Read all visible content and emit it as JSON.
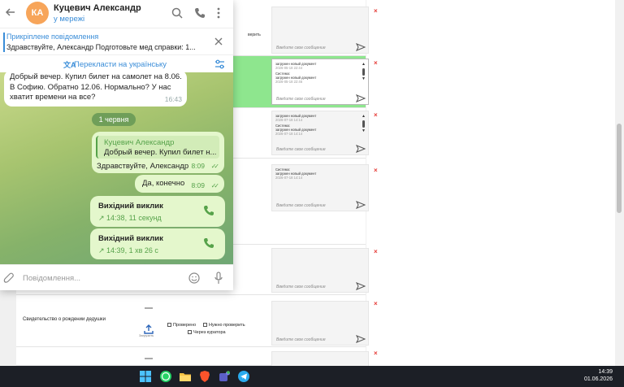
{
  "telegram": {
    "avatar_initials": "КА",
    "chat_name": "Куцевич Александр",
    "chat_status": "у мережі",
    "pinned_title": "Прикріплене повідомлення",
    "pinned_text": "Здравствуйте, Александр Подготовьте мед справки: 1...",
    "translate_label": "Перекласти на українську",
    "translate_icon": "文A",
    "messages": {
      "msg1_text": "Добрый вечер. Купил билет на самолет на 8.06. В Софию. Обратно 12.06. Нормально? У нас хватит времени на все?",
      "msg1_time": "16:43",
      "date_chip": "1 червня",
      "reply_name": "Куцевич Александр",
      "reply_text": "Добрый вечер. Купил билет н...",
      "msg2_text": "Здравствуйте, Александр",
      "msg2_time": "8:09",
      "msg3_text": "Да, конечно",
      "msg3_time": "8:09",
      "call1_title": "Вихідний виклик",
      "call1_meta": "↗ 14:38, 11 секунд",
      "call2_title": "Вихідний виклик",
      "call2_meta": "↗ 14:39, 1 хв 26 с"
    },
    "composer_placeholder": "Повідомлення..."
  },
  "background_app": {
    "verify_label": "верить",
    "comment_placeholder": "Введите свое сообщение",
    "close_mark": "×",
    "system_label": "Система:",
    "doc_uploaded": "загружен новый документ",
    "row2_dates": [
      "2026-05-18 22:44",
      "2026-05-18 22:46"
    ],
    "row3_dates": [
      "2026-07-18 14:14",
      "2026-07-18 14:14"
    ],
    "row4_dates": [
      "2026-07-18 14:14"
    ],
    "doc_label": "Свидетельство о рождении дедушки",
    "upload_label": "Загрузить",
    "check_verified": "Проверено",
    "check_need_verify": "Нужно проверить",
    "check_curator": "Через куратора"
  },
  "taskbar": {
    "time": "14:39",
    "date": "01.06.2026",
    "icons": [
      "windows-start-icon",
      "whatsapp-icon",
      "file-explorer-icon",
      "brave-browser-icon",
      "teams-icon",
      "telegram-icon"
    ]
  },
  "colors": {
    "telegram_accent": "#3a8dd8",
    "outgoing_bubble": "#e4f7cc",
    "highlight_row": "#8ee68e",
    "avatar": "#f7a55a"
  }
}
